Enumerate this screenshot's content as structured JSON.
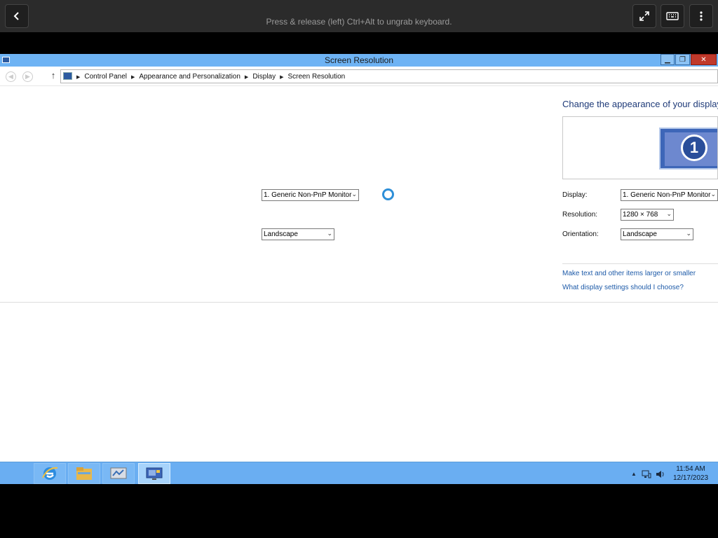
{
  "viewer": {
    "hint": "Press & release (left) Ctrl+Alt to ungrab keyboard.",
    "icons": [
      "back-icon",
      "fullscreen-icon",
      "keyboard-icon",
      "more-vertical-icon"
    ]
  },
  "window": {
    "title": "Screen Resolution",
    "controls": {
      "minimize": "▁",
      "restore": "❐",
      "close": "✕"
    }
  },
  "nav": {
    "up_glyph": "↑",
    "breadcrumb": [
      "Control Panel",
      "Appearance and Personalization",
      "Display",
      "Screen Resolution"
    ],
    "separator": "▶"
  },
  "ghost": {
    "display_value": "1. Generic Non-PnP Monitor",
    "orientation_value": "Landscape"
  },
  "panel": {
    "heading": "Change the appearance of your display",
    "monitor_number": "1",
    "display_label": "Display:",
    "display_value": "1. Generic Non-PnP Monitor",
    "resolution_label": "Resolution:",
    "resolution_value": "1280 × 768",
    "orientation_label": "Orientation:",
    "orientation_value": "Landscape",
    "link_text_size": "Make text and other items larger or smaller",
    "link_help": "What display settings should I choose?"
  },
  "taskbar": {
    "apps": [
      "internet-explorer",
      "file-explorer",
      "server-manager",
      "screen-resolution"
    ],
    "clock_time": "11:54 AM",
    "clock_date": "12/17/2023",
    "tray_up": "▲"
  },
  "colors": {
    "titlebar": "#6eb3f4",
    "taskbar": "#6aaef2",
    "link": "#1d5aa8",
    "heading": "#1e3a78"
  }
}
